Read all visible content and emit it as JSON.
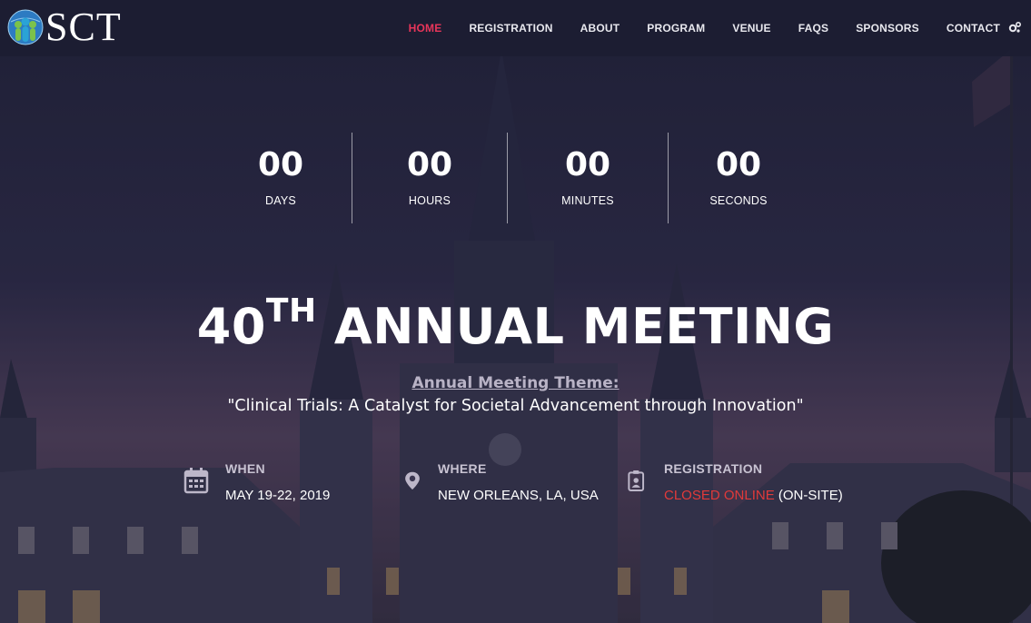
{
  "brand": {
    "logo_text": "SCT"
  },
  "nav": {
    "items": [
      {
        "label": "HOME",
        "active": true
      },
      {
        "label": "REGISTRATION",
        "active": false
      },
      {
        "label": "ABOUT",
        "active": false
      },
      {
        "label": "PROGRAM",
        "active": false
      },
      {
        "label": "VENUE",
        "active": false
      },
      {
        "label": "FAQS",
        "active": false
      },
      {
        "label": "SPONSORS",
        "active": false
      },
      {
        "label": "CONTACT",
        "active": false
      }
    ],
    "settings_icon": "cogs-icon",
    "active_color": "#e8355a"
  },
  "countdown": {
    "days": {
      "value": "00",
      "label": "DAYS"
    },
    "hours": {
      "value": "00",
      "label": "HOURS"
    },
    "minutes": {
      "value": "00",
      "label": "MINUTES"
    },
    "seconds": {
      "value": "00",
      "label": "SECONDS"
    }
  },
  "hero": {
    "ordinal_number": "40",
    "ordinal_suffix": "TH",
    "title_rest": "ANNUAL MEETING",
    "theme_label": "Annual Meeting Theme:",
    "theme_text": "\"Clinical Trials: A Catalyst for Societal Advancement through Innovation\""
  },
  "info": {
    "when": {
      "title": "WHEN",
      "value": "MAY 19-22, 2019",
      "icon": "calendar-icon"
    },
    "where": {
      "title": "WHERE",
      "value": "NEW ORLEANS, LA, USA",
      "icon": "map-pin-icon"
    },
    "registration": {
      "title": "REGISTRATION",
      "status": "CLOSED ONLINE",
      "note": "(ON-SITE)",
      "icon": "id-badge-icon",
      "status_color": "#e23a3a"
    }
  }
}
